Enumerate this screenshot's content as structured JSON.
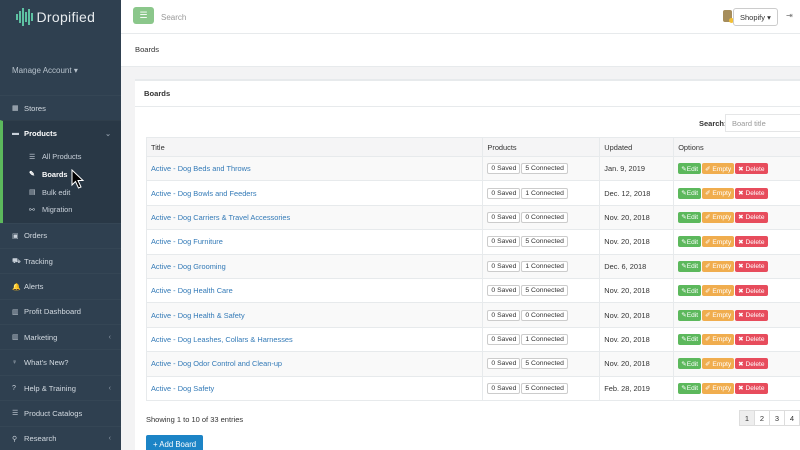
{
  "brand": {
    "name": "Dropified"
  },
  "sidebar": {
    "manage_account": "Manage Account ▾",
    "items": [
      {
        "label": "Stores",
        "icon": "▦"
      },
      {
        "label": "Products",
        "icon": "▬",
        "chev": "⌄"
      },
      {
        "label": "Orders",
        "icon": "▣"
      },
      {
        "label": "Tracking",
        "icon": "⛟"
      },
      {
        "label": "Alerts",
        "icon": "🔔"
      },
      {
        "label": "Profit Dashboard",
        "icon": "▥"
      },
      {
        "label": "Marketing",
        "icon": "▥",
        "chev": "‹"
      },
      {
        "label": "What's New?",
        "icon": "♀"
      },
      {
        "label": "Help & Training",
        "icon": "?",
        "chev": "‹"
      },
      {
        "label": "Product Catalogs",
        "icon": "☰"
      },
      {
        "label": "Research",
        "icon": "⚲",
        "chev": "‹"
      }
    ],
    "sub_items": [
      {
        "label": "All Products",
        "icon": "☰"
      },
      {
        "label": "Boards",
        "icon": "✎"
      },
      {
        "label": "Bulk edit",
        "icon": "▤"
      },
      {
        "label": "Migration",
        "icon": "⚯"
      }
    ]
  },
  "topbar": {
    "menu_icon": "☰",
    "search_placeholder": "Search",
    "store_button": "Shopify ▾",
    "logout_icon": "⇥"
  },
  "page": {
    "heading": "Boards"
  },
  "panel": {
    "title": "Boards",
    "search_label": "Search:",
    "search_placeholder": "Board title",
    "columns": [
      "Title",
      "Products",
      "Updated",
      "Options"
    ],
    "option_labels": {
      "edit": "✎Edit",
      "empty": "✐ Empty",
      "delete": "✖ Delete"
    },
    "rows": [
      {
        "title": "Active - Dog Beds and Throws",
        "saved": "0 Saved",
        "connected": "5 Connected",
        "updated": "Jan. 9, 2019"
      },
      {
        "title": "Active - Dog Bowls and Feeders",
        "saved": "0 Saved",
        "connected": "1 Connected",
        "updated": "Dec. 12, 2018"
      },
      {
        "title": "Active - Dog Carriers & Travel Accessories",
        "saved": "0 Saved",
        "connected": "0 Connected",
        "updated": "Nov. 20, 2018"
      },
      {
        "title": "Active - Dog Furniture",
        "saved": "0 Saved",
        "connected": "5 Connected",
        "updated": "Nov. 20, 2018"
      },
      {
        "title": "Active - Dog Grooming",
        "saved": "0 Saved",
        "connected": "1 Connected",
        "updated": "Dec. 6, 2018"
      },
      {
        "title": "Active - Dog Health Care",
        "saved": "0 Saved",
        "connected": "5 Connected",
        "updated": "Nov. 20, 2018"
      },
      {
        "title": "Active - Dog Health & Safety",
        "saved": "0 Saved",
        "connected": "0 Connected",
        "updated": "Nov. 20, 2018"
      },
      {
        "title": "Active - Dog Leashes, Collars & Harnesses",
        "saved": "0 Saved",
        "connected": "1 Connected",
        "updated": "Nov. 20, 2018"
      },
      {
        "title": "Active - Dog Odor Control and Clean-up",
        "saved": "0 Saved",
        "connected": "5 Connected",
        "updated": "Nov. 20, 2018"
      },
      {
        "title": "Active - Dog Safety",
        "saved": "0 Saved",
        "connected": "5 Connected",
        "updated": "Feb. 28, 2019"
      }
    ],
    "entries_text": "Showing 1 to 10 of 33 entries",
    "pages": [
      "1",
      "2",
      "3",
      "4"
    ],
    "add_button": "+ Add Board"
  },
  "colors": {
    "sidebar": "#2f4050",
    "accent": "#5cb85c",
    "primary": "#1c84c6",
    "warning": "#f0ad4e",
    "danger": "#e74c5c"
  }
}
